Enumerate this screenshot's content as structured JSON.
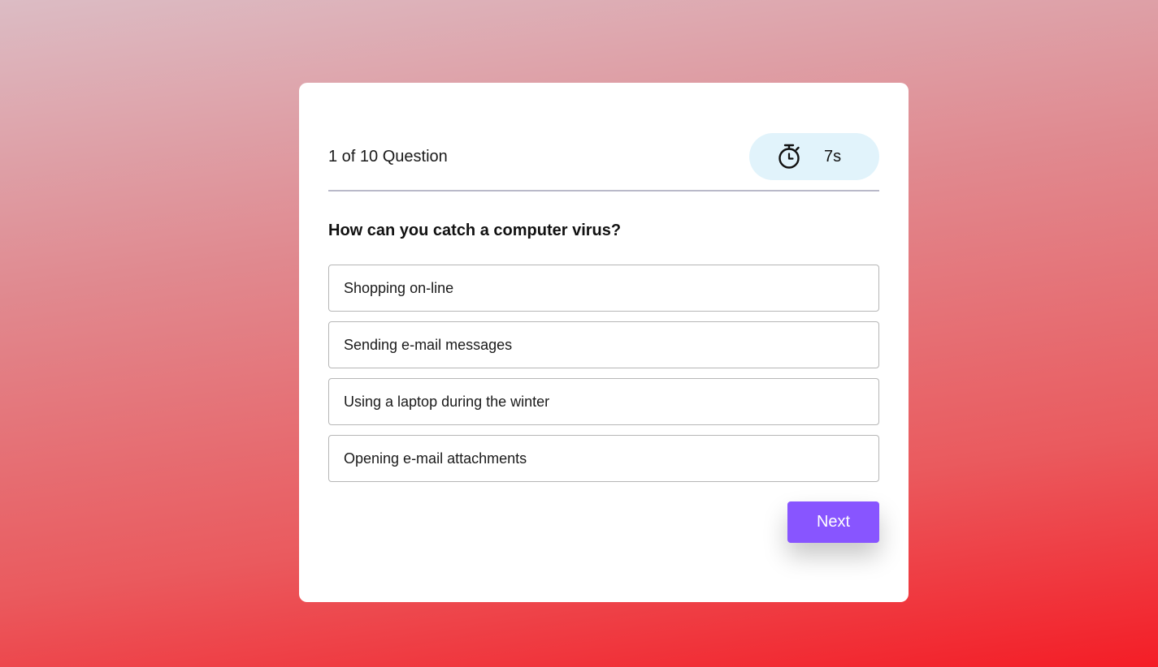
{
  "quiz": {
    "counter": "1 of 10 Question",
    "timer": {
      "icon": "stopwatch-icon",
      "value": "7s"
    },
    "question": "How can you catch a computer virus?",
    "options": [
      "Shopping on-line",
      "Sending e-mail messages",
      "Using a laptop during the winter",
      "Opening e-mail attachments"
    ],
    "next_label": "Next"
  },
  "colors": {
    "accent": "#8855ff",
    "timer_bg": "#e1f3fb",
    "background_top": "#dcbcc4",
    "background_bottom": "#f41d26"
  }
}
